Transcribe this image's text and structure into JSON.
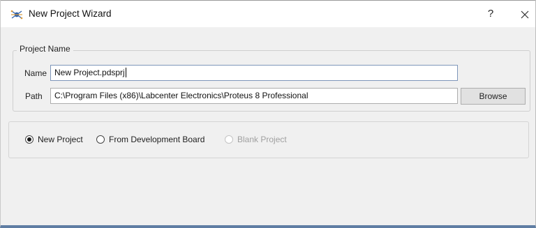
{
  "window": {
    "title": "New Project Wizard",
    "help_label": "?"
  },
  "project_name_group": {
    "title": "Project Name",
    "name_label": "Name",
    "name_value": "New Project.pdsprj",
    "path_label": "Path",
    "path_value": "C:\\Program Files (x86)\\Labcenter Electronics\\Proteus 8 Professional",
    "browse_label": "Browse"
  },
  "project_type": {
    "options": [
      {
        "label": "New Project",
        "selected": true,
        "enabled": true
      },
      {
        "label": "From Development Board",
        "selected": false,
        "enabled": true
      },
      {
        "label": "Blank Project",
        "selected": false,
        "enabled": false
      }
    ]
  },
  "colors": {
    "window_bg": "#f0f0f0",
    "titlebar_bg": "#ffffff",
    "frame_accent": "#5f7da3",
    "disabled_text": "#a0a0a0"
  },
  "icons": {
    "app": "proteus-app-icon",
    "close": "close-icon"
  }
}
